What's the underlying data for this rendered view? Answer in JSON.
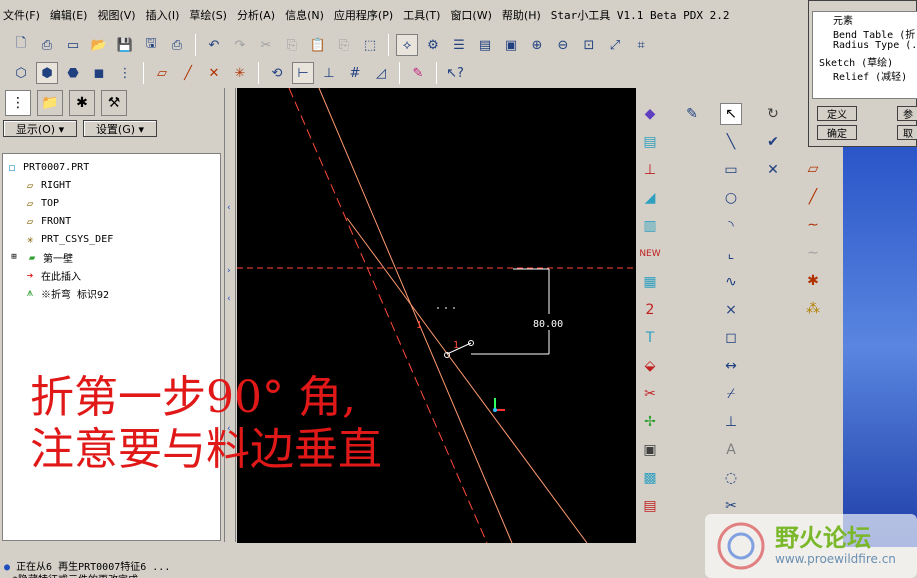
{
  "menu": {
    "items": [
      "文件(F)",
      "编辑(E)",
      "视图(V)",
      "插入(I)",
      "草绘(S)",
      "分析(A)",
      "信息(N)",
      "应用程序(P)",
      "工具(T)",
      "窗口(W)",
      "帮助(H)"
    ],
    "app_title": "Star小工具 V1.1 Beta  PDX 2.2"
  },
  "panel": {
    "show_button": "显示(O) ▾",
    "settings_button": "设置(G) ▾"
  },
  "tree": {
    "root": "PRT0007.PRT",
    "items": [
      "RIGHT",
      "TOP",
      "FRONT",
      "PRT_CSYS_DEF",
      "第一壁",
      "在此插入",
      "※折弯 标识92"
    ]
  },
  "canvas": {
    "dimension_text": "80.00",
    "label_small": "1"
  },
  "dialog": {
    "header": "元素",
    "list": [
      "Bend Table (折...",
      "Radius Type (...",
      "Sketch (草绘)",
      "Relief (减轻)"
    ],
    "define_button": "定义",
    "ok_button": "确定",
    "ref_button": "参",
    "cancel_button": "取"
  },
  "overlay_note": {
    "line1": "折第一步90° 角,",
    "line2": "注意要与料边垂直"
  },
  "status": {
    "line1": "正在从6 再生PRT0007特征6 ...",
    "line2": "*隐藏特征或元件的更改完成"
  },
  "watermark": {
    "title": "野火论坛",
    "url": "www.proewildfire.cn"
  },
  "colors": {
    "canvas_bg": "#000000",
    "sketch_line": "#ff9a70",
    "reference_dashed": "#ff4a3a",
    "dimension": "#ffffff",
    "note_red": "#e01818"
  }
}
